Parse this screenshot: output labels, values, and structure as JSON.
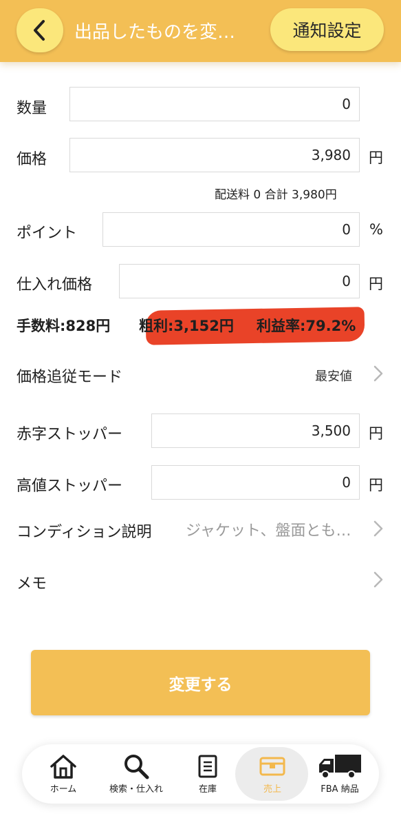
{
  "header": {
    "title": "出品したものを変…",
    "notify_button": "通知設定"
  },
  "form": {
    "quantity": {
      "label": "数量",
      "value": "0"
    },
    "price": {
      "label": "価格",
      "value": "3,980",
      "unit": "円",
      "note": "配送料 0  合計 3,980円"
    },
    "points": {
      "label": "ポイント",
      "value": "0",
      "unit": "%"
    },
    "cost": {
      "label": "仕入れ価格",
      "value": "0",
      "unit": "円"
    },
    "summary": {
      "fee": "手数料:828円",
      "gross": "粗利:3,152円",
      "rate": "利益率:79.2%"
    },
    "tracking_mode": {
      "label": "価格追従モード",
      "value": "最安値"
    },
    "loss_stopper": {
      "label": "赤字ストッパー",
      "value": "3,500",
      "unit": "円"
    },
    "high_stopper": {
      "label": "高値ストッパー",
      "value": "0",
      "unit": "円"
    },
    "condition": {
      "label": "コンディション説明",
      "value": "ジャケット、盤面とも良好です"
    },
    "memo": {
      "label": "メモ"
    }
  },
  "submit_label": "変更する",
  "tabs": [
    {
      "label": "ホーム",
      "icon": "home-icon"
    },
    {
      "label": "検索・仕入れ",
      "icon": "search-icon"
    },
    {
      "label": "在庫",
      "icon": "inventory-icon"
    },
    {
      "label": "売上",
      "icon": "box-icon",
      "active": true
    },
    {
      "label": "FBA 納品",
      "icon": "truck-icon"
    }
  ],
  "colors": {
    "brand": "#f3bf55",
    "button_pill": "#fbe77b",
    "highlight": "#e8391c",
    "active_tab": "#f3b84c"
  }
}
